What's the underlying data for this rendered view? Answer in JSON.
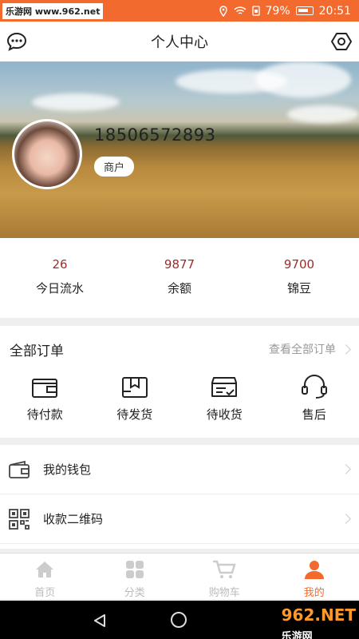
{
  "status_bar": {
    "watermark": "乐游网 www.962.net",
    "battery": "79%",
    "time": "20:51"
  },
  "header": {
    "title": "个人中心",
    "left_icon": "chat-bubble-icon",
    "right_icon": "settings-gear-icon"
  },
  "profile": {
    "phone": "18506572893",
    "role": "商户"
  },
  "stats": [
    {
      "value": "26",
      "label": "今日流水"
    },
    {
      "value": "9877",
      "label": "余额"
    },
    {
      "value": "9700",
      "label": "锦豆"
    }
  ],
  "orders": {
    "title": "全部订单",
    "view_all": "查看全部订单",
    "items": [
      {
        "label": "待付款",
        "icon": "wallet-icon"
      },
      {
        "label": "待发货",
        "icon": "package-icon"
      },
      {
        "label": "待收货",
        "icon": "truck-icon"
      },
      {
        "label": "售后",
        "icon": "headset-icon"
      }
    ]
  },
  "menu": [
    {
      "label": "我的钱包",
      "icon": "wallet-icon"
    },
    {
      "label": "收款二维码",
      "icon": "qrcode-icon"
    }
  ],
  "tabs": [
    {
      "label": "首页",
      "icon": "home-icon"
    },
    {
      "label": "分类",
      "icon": "grid-icon"
    },
    {
      "label": "购物车",
      "icon": "cart-icon"
    },
    {
      "label": "我的",
      "icon": "user-icon",
      "active": true
    }
  ],
  "nav_watermark": {
    "brand": "962",
    "suffix": ".NET",
    "sub": "乐游网"
  },
  "colors": {
    "accent": "#f26a2e",
    "stat_value": "#9b2c2c"
  }
}
